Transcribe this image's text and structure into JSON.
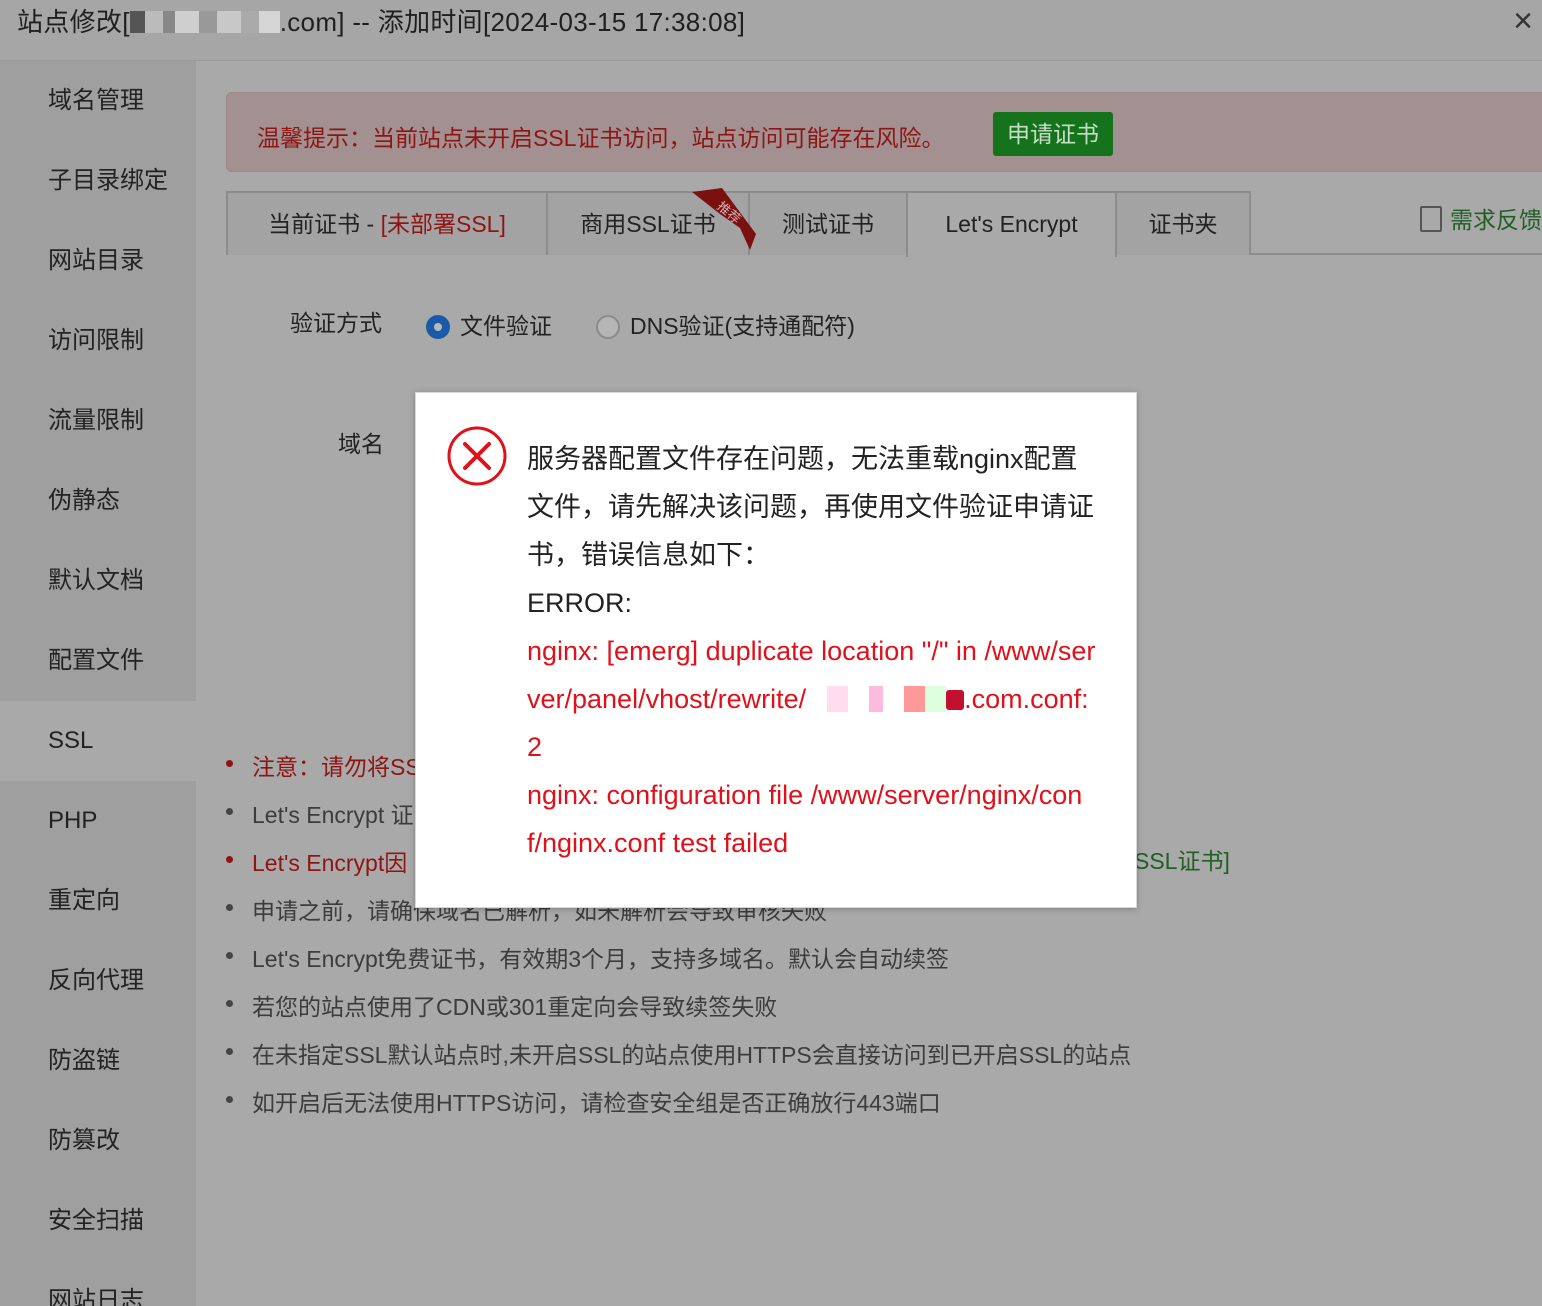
{
  "window": {
    "title_prefix": "站点修改[",
    "title_suffix": ".com] -- 添加时间[2024-03-15 17:38:08]",
    "close_symbol": "×"
  },
  "sidebar": {
    "items": [
      {
        "label": "域名管理"
      },
      {
        "label": "子目录绑定"
      },
      {
        "label": "网站目录"
      },
      {
        "label": "访问限制"
      },
      {
        "label": "流量限制"
      },
      {
        "label": "伪静态"
      },
      {
        "label": "默认文档"
      },
      {
        "label": "配置文件"
      },
      {
        "label": "SSL"
      },
      {
        "label": "PHP"
      },
      {
        "label": "重定向"
      },
      {
        "label": "反向代理"
      },
      {
        "label": "防盗链"
      },
      {
        "label": "防篡改"
      },
      {
        "label": "安全扫描"
      },
      {
        "label": "网站日志"
      }
    ],
    "active": "SSL"
  },
  "alert": {
    "text": "温馨提示：当前站点未开启SSL证书访问，站点访问可能存在风险。",
    "button": "申请证书"
  },
  "tabs": {
    "current_prefix": "当前证书 - ",
    "current_status": "[未部署SSL]",
    "commercial": "商用SSL证书",
    "ribbon": "推荐",
    "test": "测试证书",
    "letsencrypt": "Let's Encrypt",
    "folder": "证书夹",
    "active": "Let's Encrypt"
  },
  "feedback": {
    "label": "需求反馈"
  },
  "form": {
    "verify_label": "验证方式",
    "option_file": "文件验证",
    "option_dns": "DNS验证(支持通配符)",
    "selected": "文件验证",
    "domain_label": "域名"
  },
  "notes": {
    "items": [
      {
        "text": "注意：请勿将SS",
        "style": "red"
      },
      {
        "text": "Let's Encrypt 证",
        "style": "gray"
      },
      {
        "text": "Let's Encrypt因",
        "style": "red"
      },
      {
        "text": "申请之前，请确保域名已解析，如未解析会导致审核失败",
        "style": "gray"
      },
      {
        "text": "Let's Encrypt免费证书，有效期3个月，支持多域名。默认会自动续签",
        "style": "gray"
      },
      {
        "text": "若您的站点使用了CDN或301重定向会导致续签失败",
        "style": "gray"
      },
      {
        "text": "在未指定SSL默认站点时,未开启SSL的站点使用HTTPS会直接访问到已开启SSL的站点",
        "style": "gray"
      },
      {
        "text": "如开启后无法使用HTTPS访问，请检查安全组是否正确放行443端口",
        "style": "gray"
      }
    ],
    "ssl_link_fragment": "SSL证书]"
  },
  "modal": {
    "message": "服务器配置文件存在问题，无法重载nginx配置文件，请先解决该问题，再使用文件验证申请证书，错误信息如下：",
    "error_heading": "ERROR:",
    "error_line1": "nginx: [emerg] duplicate location \"/\" in /www/server/panel/vhost/rewrite/",
    "error_line1_end": ".com.conf:2",
    "error_line2": "nginx: configuration file /www/server/nginx/conf/nginx.conf test failed",
    "icon": "error-circle-icon"
  },
  "colors": {
    "error_red": "#e0111b",
    "button_green": "#15741b",
    "radio_blue": "#1b5aa8"
  }
}
